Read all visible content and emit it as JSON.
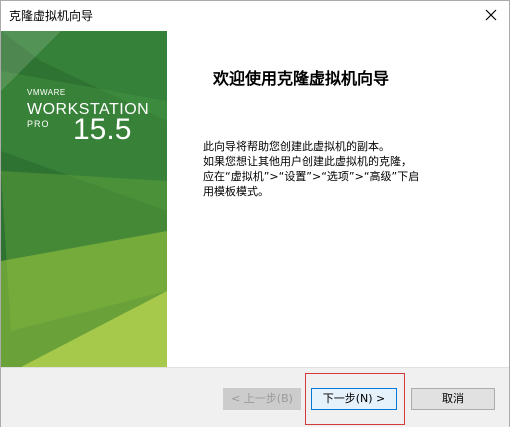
{
  "window": {
    "title": "克隆虚拟机向导"
  },
  "banner": {
    "brand": "VMWARE",
    "product": "WORKSTATION",
    "edition": "PRO",
    "version": "15.5"
  },
  "content": {
    "heading": "欢迎使用克隆虚拟机向导",
    "lines": [
      "此向导将帮助您创建此虚拟机的副本。",
      "如果您想让其他用户创建此虚拟机的克隆，",
      "应在“虚拟机”>“设置”>“选项”>“高级”下启",
      "用模板模式。"
    ]
  },
  "buttons": {
    "back": "< 上一步(B)",
    "next": "下一步(N) >",
    "cancel": "取消"
  },
  "colors": {
    "banner_green": "#2c6e2e",
    "accent_blue": "#0078d7",
    "highlight_red": "#d23a3a"
  }
}
